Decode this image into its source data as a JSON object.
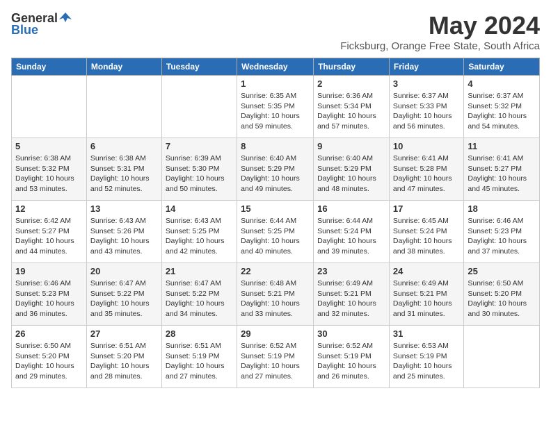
{
  "header": {
    "logo_general": "General",
    "logo_blue": "Blue",
    "title": "May 2024",
    "location": "Ficksburg, Orange Free State, South Africa"
  },
  "weekdays": [
    "Sunday",
    "Monday",
    "Tuesday",
    "Wednesday",
    "Thursday",
    "Friday",
    "Saturday"
  ],
  "weeks": [
    [
      {
        "day": "",
        "info": ""
      },
      {
        "day": "",
        "info": ""
      },
      {
        "day": "",
        "info": ""
      },
      {
        "day": "1",
        "info": "Sunrise: 6:35 AM\nSunset: 5:35 PM\nDaylight: 10 hours\nand 59 minutes."
      },
      {
        "day": "2",
        "info": "Sunrise: 6:36 AM\nSunset: 5:34 PM\nDaylight: 10 hours\nand 57 minutes."
      },
      {
        "day": "3",
        "info": "Sunrise: 6:37 AM\nSunset: 5:33 PM\nDaylight: 10 hours\nand 56 minutes."
      },
      {
        "day": "4",
        "info": "Sunrise: 6:37 AM\nSunset: 5:32 PM\nDaylight: 10 hours\nand 54 minutes."
      }
    ],
    [
      {
        "day": "5",
        "info": "Sunrise: 6:38 AM\nSunset: 5:32 PM\nDaylight: 10 hours\nand 53 minutes."
      },
      {
        "day": "6",
        "info": "Sunrise: 6:38 AM\nSunset: 5:31 PM\nDaylight: 10 hours\nand 52 minutes."
      },
      {
        "day": "7",
        "info": "Sunrise: 6:39 AM\nSunset: 5:30 PM\nDaylight: 10 hours\nand 50 minutes."
      },
      {
        "day": "8",
        "info": "Sunrise: 6:40 AM\nSunset: 5:29 PM\nDaylight: 10 hours\nand 49 minutes."
      },
      {
        "day": "9",
        "info": "Sunrise: 6:40 AM\nSunset: 5:29 PM\nDaylight: 10 hours\nand 48 minutes."
      },
      {
        "day": "10",
        "info": "Sunrise: 6:41 AM\nSunset: 5:28 PM\nDaylight: 10 hours\nand 47 minutes."
      },
      {
        "day": "11",
        "info": "Sunrise: 6:41 AM\nSunset: 5:27 PM\nDaylight: 10 hours\nand 45 minutes."
      }
    ],
    [
      {
        "day": "12",
        "info": "Sunrise: 6:42 AM\nSunset: 5:27 PM\nDaylight: 10 hours\nand 44 minutes."
      },
      {
        "day": "13",
        "info": "Sunrise: 6:43 AM\nSunset: 5:26 PM\nDaylight: 10 hours\nand 43 minutes."
      },
      {
        "day": "14",
        "info": "Sunrise: 6:43 AM\nSunset: 5:25 PM\nDaylight: 10 hours\nand 42 minutes."
      },
      {
        "day": "15",
        "info": "Sunrise: 6:44 AM\nSunset: 5:25 PM\nDaylight: 10 hours\nand 40 minutes."
      },
      {
        "day": "16",
        "info": "Sunrise: 6:44 AM\nSunset: 5:24 PM\nDaylight: 10 hours\nand 39 minutes."
      },
      {
        "day": "17",
        "info": "Sunrise: 6:45 AM\nSunset: 5:24 PM\nDaylight: 10 hours\nand 38 minutes."
      },
      {
        "day": "18",
        "info": "Sunrise: 6:46 AM\nSunset: 5:23 PM\nDaylight: 10 hours\nand 37 minutes."
      }
    ],
    [
      {
        "day": "19",
        "info": "Sunrise: 6:46 AM\nSunset: 5:23 PM\nDaylight: 10 hours\nand 36 minutes."
      },
      {
        "day": "20",
        "info": "Sunrise: 6:47 AM\nSunset: 5:22 PM\nDaylight: 10 hours\nand 35 minutes."
      },
      {
        "day": "21",
        "info": "Sunrise: 6:47 AM\nSunset: 5:22 PM\nDaylight: 10 hours\nand 34 minutes."
      },
      {
        "day": "22",
        "info": "Sunrise: 6:48 AM\nSunset: 5:21 PM\nDaylight: 10 hours\nand 33 minutes."
      },
      {
        "day": "23",
        "info": "Sunrise: 6:49 AM\nSunset: 5:21 PM\nDaylight: 10 hours\nand 32 minutes."
      },
      {
        "day": "24",
        "info": "Sunrise: 6:49 AM\nSunset: 5:21 PM\nDaylight: 10 hours\nand 31 minutes."
      },
      {
        "day": "25",
        "info": "Sunrise: 6:50 AM\nSunset: 5:20 PM\nDaylight: 10 hours\nand 30 minutes."
      }
    ],
    [
      {
        "day": "26",
        "info": "Sunrise: 6:50 AM\nSunset: 5:20 PM\nDaylight: 10 hours\nand 29 minutes."
      },
      {
        "day": "27",
        "info": "Sunrise: 6:51 AM\nSunset: 5:20 PM\nDaylight: 10 hours\nand 28 minutes."
      },
      {
        "day": "28",
        "info": "Sunrise: 6:51 AM\nSunset: 5:19 PM\nDaylight: 10 hours\nand 27 minutes."
      },
      {
        "day": "29",
        "info": "Sunrise: 6:52 AM\nSunset: 5:19 PM\nDaylight: 10 hours\nand 27 minutes."
      },
      {
        "day": "30",
        "info": "Sunrise: 6:52 AM\nSunset: 5:19 PM\nDaylight: 10 hours\nand 26 minutes."
      },
      {
        "day": "31",
        "info": "Sunrise: 6:53 AM\nSunset: 5:19 PM\nDaylight: 10 hours\nand 25 minutes."
      },
      {
        "day": "",
        "info": ""
      }
    ]
  ]
}
